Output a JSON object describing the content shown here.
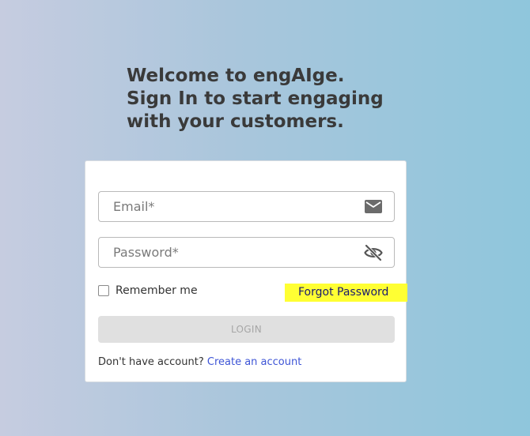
{
  "heading": {
    "line1": "Welcome to engAIge.",
    "line2": "Sign In to start engaging",
    "line3": "with your customers."
  },
  "form": {
    "email": {
      "value": "",
      "placeholder": "Email*",
      "icon": "mail-icon"
    },
    "password": {
      "value": "",
      "placeholder": "Password*",
      "icon": "eye-off-icon"
    },
    "remember_label": "Remember me",
    "remember_checked": false,
    "forgot_label": "Forgot Password",
    "login_label": "LOGIN",
    "no_account_text": "Don't have account?",
    "create_account_label": "Create an account"
  },
  "colors": {
    "highlight": "#ffff33",
    "link": "#3e55d6",
    "button_disabled_bg": "#e0e0e0",
    "heading_text": "#3a3a3a"
  }
}
